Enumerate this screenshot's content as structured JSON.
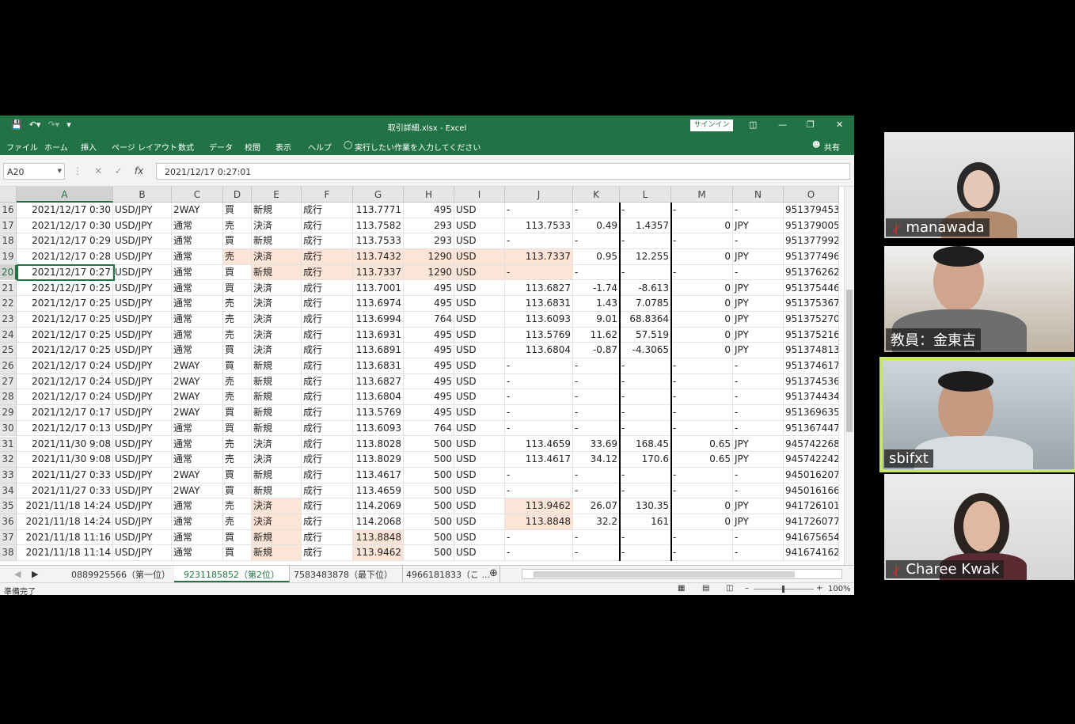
{
  "excel": {
    "title": "取引詳細.xlsx  -  Excel",
    "signin": "サインイン",
    "ribbon_tabs": [
      "ファイル",
      "ホーム",
      "挿入",
      "ページ レイアウト",
      "数式",
      "データ",
      "校閲",
      "表示",
      "ヘルプ"
    ],
    "tell_me": "実行したい作業を入力してください",
    "share": "共有",
    "name_box": "A20",
    "formula": "2021/12/17  0:27:01",
    "columns": [
      "A",
      "B",
      "C",
      "D",
      "E",
      "F",
      "G",
      "H",
      "I",
      "J",
      "K",
      "L",
      "M",
      "N",
      "O"
    ],
    "rows": [
      {
        "n": "16",
        "A": "2021/12/17 0:30",
        "B": "USD/JPY",
        "C": "2WAY",
        "D": "買",
        "E": "新規",
        "F": "成行",
        "G": "113.7771",
        "H": "495",
        "I": "USD",
        "J": "-",
        "K": "-",
        "L": "-",
        "M": "-",
        "N": "-",
        "O": "951379453"
      },
      {
        "n": "17",
        "A": "2021/12/17 0:30",
        "B": "USD/JPY",
        "C": "通常",
        "D": "売",
        "E": "決済",
        "F": "成行",
        "G": "113.7582",
        "H": "293",
        "I": "USD",
        "J": "113.7533",
        "K": "0.49",
        "L": "1.4357",
        "M": "0",
        "N": "JPY",
        "O": "951379005"
      },
      {
        "n": "18",
        "A": "2021/12/17 0:29",
        "B": "USD/JPY",
        "C": "通常",
        "D": "買",
        "E": "新規",
        "F": "成行",
        "G": "113.7533",
        "H": "293",
        "I": "USD",
        "J": "-",
        "K": "-",
        "L": "-",
        "M": "-",
        "N": "-",
        "O": "951377992"
      },
      {
        "n": "19",
        "A": "2021/12/17 0:28",
        "B": "USD/JPY",
        "C": "通常",
        "D": "売",
        "E": "決済",
        "F": "成行",
        "G": "113.7432",
        "H": "1290",
        "I": "USD",
        "J": "113.7337",
        "K": "0.95",
        "L": "12.255",
        "M": "0",
        "N": "JPY",
        "O": "951377496"
      },
      {
        "n": "20",
        "A": "2021/12/17 0:27",
        "B": "USD/JPY",
        "C": "通常",
        "D": "買",
        "E": "新規",
        "F": "成行",
        "G": "113.7337",
        "H": "1290",
        "I": "USD",
        "J": "-",
        "K": "-",
        "L": "-",
        "M": "-",
        "N": "-",
        "O": "951376262"
      },
      {
        "n": "21",
        "A": "2021/12/17 0:25",
        "B": "USD/JPY",
        "C": "通常",
        "D": "買",
        "E": "決済",
        "F": "成行",
        "G": "113.7001",
        "H": "495",
        "I": "USD",
        "J": "113.6827",
        "K": "-1.74",
        "L": "-8.613",
        "M": "0",
        "N": "JPY",
        "O": "951375446"
      },
      {
        "n": "22",
        "A": "2021/12/17 0:25",
        "B": "USD/JPY",
        "C": "通常",
        "D": "売",
        "E": "決済",
        "F": "成行",
        "G": "113.6974",
        "H": "495",
        "I": "USD",
        "J": "113.6831",
        "K": "1.43",
        "L": "7.0785",
        "M": "0",
        "N": "JPY",
        "O": "951375367"
      },
      {
        "n": "23",
        "A": "2021/12/17 0:25",
        "B": "USD/JPY",
        "C": "通常",
        "D": "売",
        "E": "決済",
        "F": "成行",
        "G": "113.6994",
        "H": "764",
        "I": "USD",
        "J": "113.6093",
        "K": "9.01",
        "L": "68.8364",
        "M": "0",
        "N": "JPY",
        "O": "951375270"
      },
      {
        "n": "24",
        "A": "2021/12/17 0:25",
        "B": "USD/JPY",
        "C": "通常",
        "D": "売",
        "E": "決済",
        "F": "成行",
        "G": "113.6931",
        "H": "495",
        "I": "USD",
        "J": "113.5769",
        "K": "11.62",
        "L": "57.519",
        "M": "0",
        "N": "JPY",
        "O": "951375216"
      },
      {
        "n": "25",
        "A": "2021/12/17 0:25",
        "B": "USD/JPY",
        "C": "通常",
        "D": "買",
        "E": "決済",
        "F": "成行",
        "G": "113.6891",
        "H": "495",
        "I": "USD",
        "J": "113.6804",
        "K": "-0.87",
        "L": "-4.3065",
        "M": "0",
        "N": "JPY",
        "O": "951374813"
      },
      {
        "n": "26",
        "A": "2021/12/17 0:24",
        "B": "USD/JPY",
        "C": "2WAY",
        "D": "買",
        "E": "新規",
        "F": "成行",
        "G": "113.6831",
        "H": "495",
        "I": "USD",
        "J": "-",
        "K": "-",
        "L": "-",
        "M": "-",
        "N": "-",
        "O": "951374617"
      },
      {
        "n": "27",
        "A": "2021/12/17 0:24",
        "B": "USD/JPY",
        "C": "2WAY",
        "D": "売",
        "E": "新規",
        "F": "成行",
        "G": "113.6827",
        "H": "495",
        "I": "USD",
        "J": "-",
        "K": "-",
        "L": "-",
        "M": "-",
        "N": "-",
        "O": "951374536"
      },
      {
        "n": "28",
        "A": "2021/12/17 0:24",
        "B": "USD/JPY",
        "C": "2WAY",
        "D": "売",
        "E": "新規",
        "F": "成行",
        "G": "113.6804",
        "H": "495",
        "I": "USD",
        "J": "-",
        "K": "-",
        "L": "-",
        "M": "-",
        "N": "-",
        "O": "951374434"
      },
      {
        "n": "29",
        "A": "2021/12/17 0:17",
        "B": "USD/JPY",
        "C": "2WAY",
        "D": "買",
        "E": "新規",
        "F": "成行",
        "G": "113.5769",
        "H": "495",
        "I": "USD",
        "J": "-",
        "K": "-",
        "L": "-",
        "M": "-",
        "N": "-",
        "O": "951369635"
      },
      {
        "n": "30",
        "A": "2021/12/17 0:13",
        "B": "USD/JPY",
        "C": "通常",
        "D": "買",
        "E": "新規",
        "F": "成行",
        "G": "113.6093",
        "H": "764",
        "I": "USD",
        "J": "-",
        "K": "-",
        "L": "-",
        "M": "-",
        "N": "-",
        "O": "951367447"
      },
      {
        "n": "31",
        "A": "2021/11/30 9:08",
        "B": "USD/JPY",
        "C": "通常",
        "D": "売",
        "E": "決済",
        "F": "成行",
        "G": "113.8028",
        "H": "500",
        "I": "USD",
        "J": "113.4659",
        "K": "33.69",
        "L": "168.45",
        "M": "0.65",
        "N": "JPY",
        "O": "945742268"
      },
      {
        "n": "32",
        "A": "2021/11/30 9:08",
        "B": "USD/JPY",
        "C": "通常",
        "D": "売",
        "E": "決済",
        "F": "成行",
        "G": "113.8029",
        "H": "500",
        "I": "USD",
        "J": "113.4617",
        "K": "34.12",
        "L": "170.6",
        "M": "0.65",
        "N": "JPY",
        "O": "945742242"
      },
      {
        "n": "33",
        "A": "2021/11/27 0:33",
        "B": "USD/JPY",
        "C": "2WAY",
        "D": "買",
        "E": "新規",
        "F": "成行",
        "G": "113.4617",
        "H": "500",
        "I": "USD",
        "J": "-",
        "K": "-",
        "L": "-",
        "M": "-",
        "N": "-",
        "O": "945016207"
      },
      {
        "n": "34",
        "A": "2021/11/27 0:33",
        "B": "USD/JPY",
        "C": "2WAY",
        "D": "買",
        "E": "新規",
        "F": "成行",
        "G": "113.4659",
        "H": "500",
        "I": "USD",
        "J": "-",
        "K": "-",
        "L": "-",
        "M": "-",
        "N": "-",
        "O": "945016166"
      },
      {
        "n": "35",
        "A": "2021/11/18 14:24",
        "B": "USD/JPY",
        "C": "通常",
        "D": "売",
        "E": "決済",
        "F": "成行",
        "G": "114.2069",
        "H": "500",
        "I": "USD",
        "J": "113.9462",
        "K": "26.07",
        "L": "130.35",
        "M": "0",
        "N": "JPY",
        "O": "941726101"
      },
      {
        "n": "36",
        "A": "2021/11/18 14:24",
        "B": "USD/JPY",
        "C": "通常",
        "D": "売",
        "E": "決済",
        "F": "成行",
        "G": "114.2068",
        "H": "500",
        "I": "USD",
        "J": "113.8848",
        "K": "32.2",
        "L": "161",
        "M": "0",
        "N": "JPY",
        "O": "941726077"
      },
      {
        "n": "37",
        "A": "2021/11/18 11:16",
        "B": "USD/JPY",
        "C": "通常",
        "D": "買",
        "E": "新規",
        "F": "成行",
        "G": "113.8848",
        "H": "500",
        "I": "USD",
        "J": "-",
        "K": "-",
        "L": "-",
        "M": "-",
        "N": "-",
        "O": "941675654"
      },
      {
        "n": "38",
        "A": "2021/11/18 11:14",
        "B": "USD/JPY",
        "C": "通常",
        "D": "買",
        "E": "新規",
        "F": "成行",
        "G": "113.9462",
        "H": "500",
        "I": "USD",
        "J": "-",
        "K": "-",
        "L": "-",
        "M": "-",
        "N": "-",
        "O": "941674162"
      }
    ],
    "sheets": [
      "0889925566（第一位）",
      "9231185852（第2位）",
      "7583483878（最下位）",
      "4966181833（こ ..."
    ],
    "active_sheet_index": 1,
    "status": "準備完了",
    "zoom": "100%",
    "highlight_color": "#fce4d6",
    "accent_color": "#217346"
  },
  "participants": [
    {
      "name": "manawada",
      "muted": true
    },
    {
      "name": "教員：金東吉",
      "muted": false
    },
    {
      "name": "sbifxt",
      "muted": false,
      "speaking": true
    },
    {
      "name": "Charee Kwak",
      "muted": true
    }
  ]
}
